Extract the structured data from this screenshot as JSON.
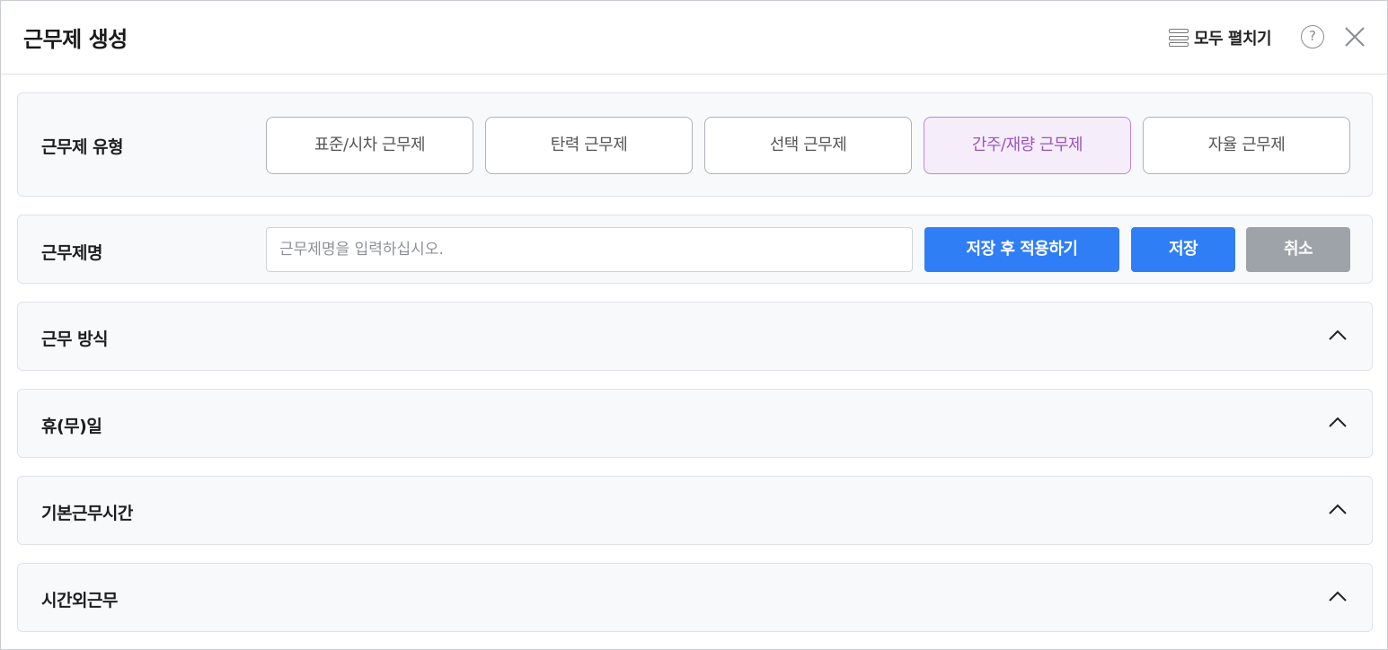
{
  "modal": {
    "title": "근무제 생성",
    "expand_all_label": "모두 펼치기",
    "help_symbol": "?"
  },
  "work_type": {
    "label": "근무제 유형",
    "options": [
      {
        "label": "표준/시차 근무제",
        "selected": false
      },
      {
        "label": "탄력 근무제",
        "selected": false
      },
      {
        "label": "선택 근무제",
        "selected": false
      },
      {
        "label": "간주/재량 근무제",
        "selected": true
      },
      {
        "label": "자율 근무제",
        "selected": false
      }
    ]
  },
  "work_name": {
    "label": "근무제명",
    "value": "",
    "placeholder": "근무제명을 입력하십시오.",
    "save_apply_label": "저장 후 적용하기",
    "save_label": "저장",
    "cancel_label": "취소"
  },
  "sections": [
    {
      "label": "근무 방식",
      "expanded": true
    },
    {
      "label": "휴(무)일",
      "expanded": true
    },
    {
      "label": "기본근무시간",
      "expanded": true
    },
    {
      "label": "시간외근무",
      "expanded": true
    }
  ],
  "colors": {
    "primary": "#2f7ef5",
    "cancel": "#9ea2a9",
    "selected_border": "#c283de",
    "selected_bg": "#f6edfb",
    "selected_text": "#9a55c0"
  },
  "icons": {
    "expand_all": "list-icon",
    "help": "help-icon",
    "close": "close-icon",
    "section_toggle": "chevron-up-icon"
  }
}
